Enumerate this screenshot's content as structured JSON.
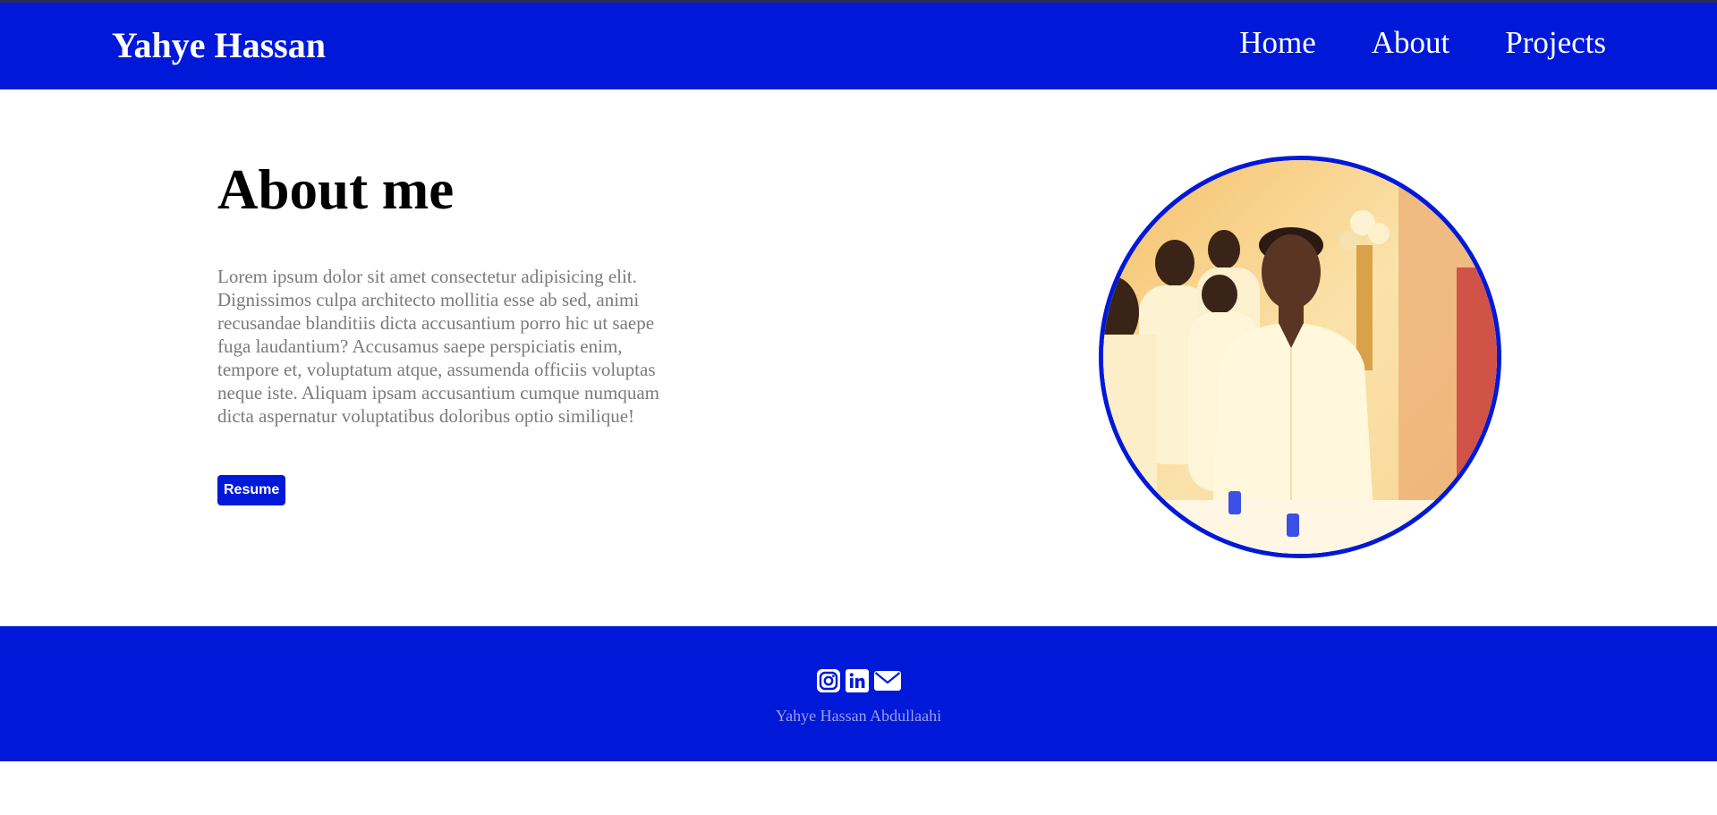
{
  "header": {
    "brand": "Yahye Hassan",
    "nav": [
      "Home",
      "About",
      "Projects"
    ]
  },
  "about": {
    "title": "About me",
    "paragraph": "Lorem ipsum dolor sit amet consectetur adipisicing elit. Dignissimos culpa architecto mollitia esse ab sed, animi recusandae blanditiis dicta accusantium porro hic ut saepe fuga laudantium? Accusamus saepe perspiciatis enim, tempore et, voluptatum atque, assumenda officiis voluptas neque iste. Aliquam ipsam accusantium cumque numquam dicta aspernatur voluptatibus doloribus optio similique!",
    "resume_label": "Resume"
  },
  "footer": {
    "social_icons": [
      "instagram-icon",
      "linkedin-icon",
      "mail-icon"
    ],
    "name": "Yahye Hassan Abdullaahi"
  },
  "colors": {
    "primary": "#0019d9",
    "text_muted": "#7b7b7b",
    "footer_text": "#9e9ee0"
  }
}
